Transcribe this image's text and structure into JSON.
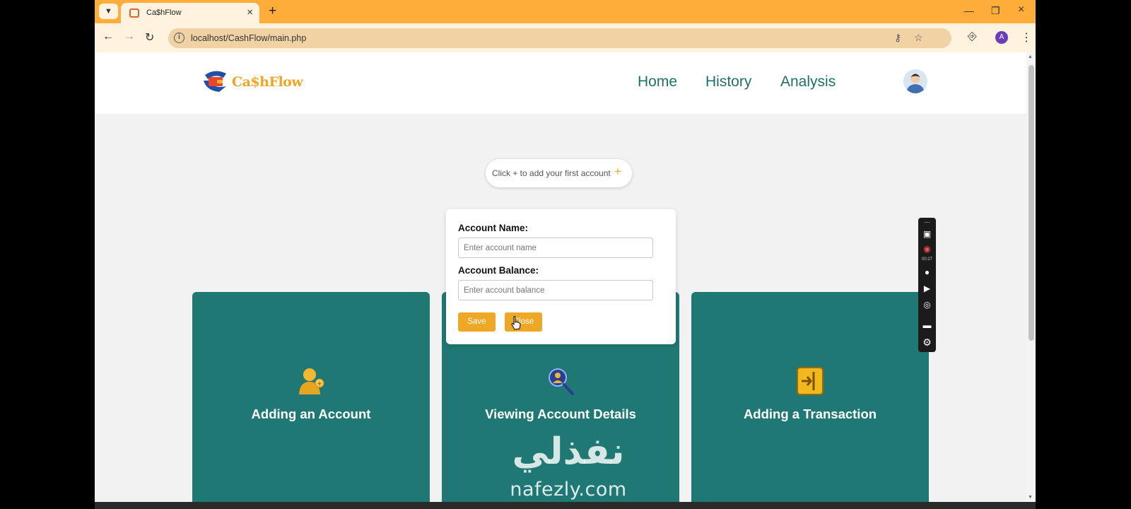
{
  "browser": {
    "tab_title": "Ca$hFlow",
    "url": "localhost/CashFlow/main.php",
    "profile_initial": "A"
  },
  "header": {
    "logo_text": "Ca$hFlow",
    "nav": [
      "Home",
      "History",
      "Analysis"
    ]
  },
  "hint": {
    "text": "Click + to add your first account",
    "plus": "+"
  },
  "modal": {
    "name_label": "Account Name:",
    "name_placeholder": "Enter account name",
    "balance_label": "Account Balance:",
    "balance_placeholder": "Enter account balance",
    "save_label": "Save",
    "close_label": "Close"
  },
  "cards": [
    {
      "title": "Adding an Account",
      "icon": "user-add-icon"
    },
    {
      "title": "Viewing Account Details",
      "icon": "magnifier-user-icon"
    },
    {
      "title": "Adding a Transaction",
      "icon": "transaction-icon"
    }
  ],
  "recorder": {
    "time": "00:27"
  },
  "watermark": {
    "arabic": "نفذلي",
    "latin": "nafezly.com"
  },
  "colors": {
    "accent": "#eea825",
    "teal": "#1f7873",
    "tabbar": "#ffad3a"
  }
}
